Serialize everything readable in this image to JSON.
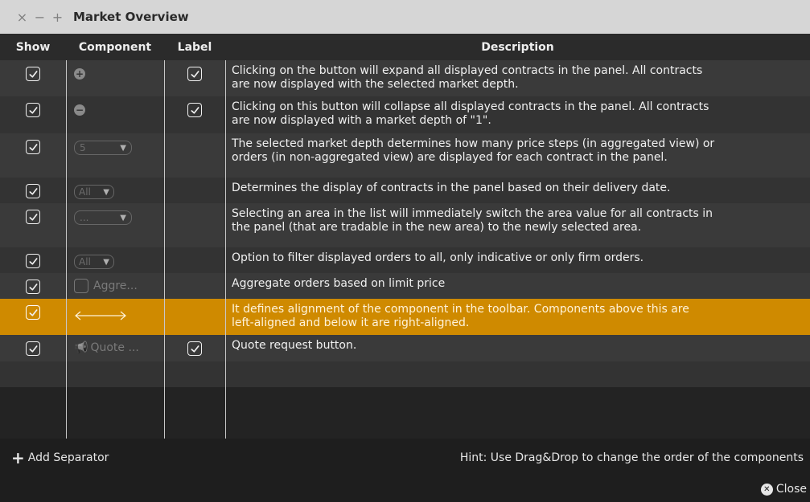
{
  "window": {
    "title": "Market Overview",
    "controls": [
      "×",
      "−",
      "+"
    ]
  },
  "header": {
    "show": "Show",
    "component": "Component",
    "label": "Label",
    "description": "Description"
  },
  "rows": [
    {
      "show": true,
      "component": {
        "type": "expand-button",
        "icon": "plus-circle-icon"
      },
      "label": true,
      "description_lines": [
        "Clicking on the button will expand all displayed contracts in the panel. All contracts",
        "are now displayed with the selected market depth."
      ]
    },
    {
      "show": true,
      "component": {
        "type": "collapse-button",
        "icon": "minus-circle-icon"
      },
      "label": true,
      "description_lines": [
        "Clicking on this button will collapse all displayed contracts in the panel. All contracts",
        "are now displayed with a market depth of \"1\"."
      ]
    },
    {
      "show": true,
      "component": {
        "type": "dropdown",
        "value": "5"
      },
      "label": false,
      "description_lines": [
        "The selected market depth determines how many price steps (in aggregated view) or",
        "orders (in non-aggregated view) are displayed for each contract in the panel."
      ]
    },
    {
      "show": true,
      "component": {
        "type": "dropdown",
        "value": "All"
      },
      "label": false,
      "description_lines": [
        "Determines the display of contracts in the panel based on their delivery date."
      ]
    },
    {
      "show": true,
      "component": {
        "type": "dropdown",
        "value": "..."
      },
      "label": false,
      "description_lines": [
        "Selecting an area in the list will immediately switch the area value for all contracts in",
        "the panel (that are tradable in the new area) to the newly selected area."
      ]
    },
    {
      "show": true,
      "component": {
        "type": "dropdown",
        "value": "All"
      },
      "label": false,
      "description_lines": [
        "Option to filter displayed orders to all, only indicative or only firm orders."
      ]
    },
    {
      "show": true,
      "component": {
        "type": "checkbox",
        "text": "Aggre..."
      },
      "label": false,
      "description_lines": [
        "Aggregate orders based on limit price"
      ]
    },
    {
      "show": true,
      "component": {
        "type": "separator",
        "icon": "double-arrow-icon"
      },
      "label": false,
      "selected": true,
      "description_lines": [
        "It defines alignment of the component in the toolbar. Components above this are",
        "left-aligned and below it are right-aligned."
      ]
    },
    {
      "show": true,
      "component": {
        "type": "quote-button",
        "icon": "megaphone-icon",
        "text": "Quote ..."
      },
      "label": true,
      "description_lines": [
        "Quote request button."
      ]
    }
  ],
  "footer": {
    "add_separator": "Add Separator",
    "hint": "Hint: Use Drag&Drop to change the order of the components",
    "close": "Close"
  },
  "colors": {
    "selected_row": "#cf8a00",
    "title_bar": "#d6d6d6",
    "background": "#1e1e1e"
  }
}
